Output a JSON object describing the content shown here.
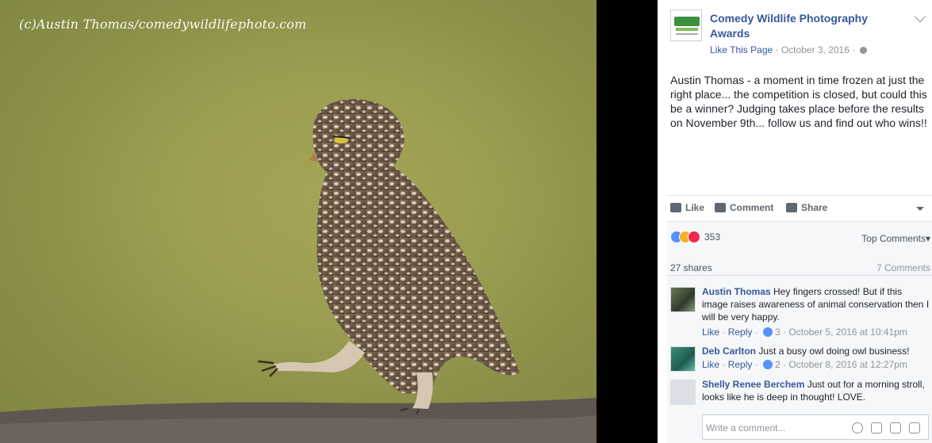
{
  "photo": {
    "watermark": "(c)Austin Thomas/comedywildlifephoto.com"
  },
  "post": {
    "page_name": "Comedy Wildlife Photography Awards",
    "like_page": "Like This Page",
    "separator": " · ",
    "date": "October 3, 2016",
    "text": "Austin Thomas - a moment in time frozen at just the right place... the competition is closed, but could this be a winner? Judging takes place before the results on November 9th... follow us and find out who wins!!"
  },
  "actions": {
    "like": "Like",
    "comment": "Comment",
    "share": "Share"
  },
  "feedback": {
    "reaction_count": "353",
    "top_comments": "Top Comments",
    "shares": "27 shares",
    "comments_count": "7 Comments"
  },
  "comments": [
    {
      "author": "Austin Thomas",
      "text": "Hey fingers crossed! But if this image raises awareness of animal conservation then I will be very happy.",
      "like": "Like",
      "reply": "Reply",
      "likes": "3",
      "timestamp": "October 5, 2016 at 10:41pm"
    },
    {
      "author": "Deb Carlton",
      "text": "Just a busy owl doing owl business!",
      "like": "Like",
      "reply": "Reply",
      "likes": "2",
      "timestamp": "October 8, 2016 at 12:27pm"
    },
    {
      "author": "Shelly Renee Berchem",
      "text": "Just out for a morning stroll, looks like he is deep in thought! LOVE."
    }
  ],
  "write_comment": {
    "placeholder": "Write a comment..."
  },
  "colors": {
    "link": "#365899",
    "meta": "#90949c",
    "background": "#000000"
  }
}
